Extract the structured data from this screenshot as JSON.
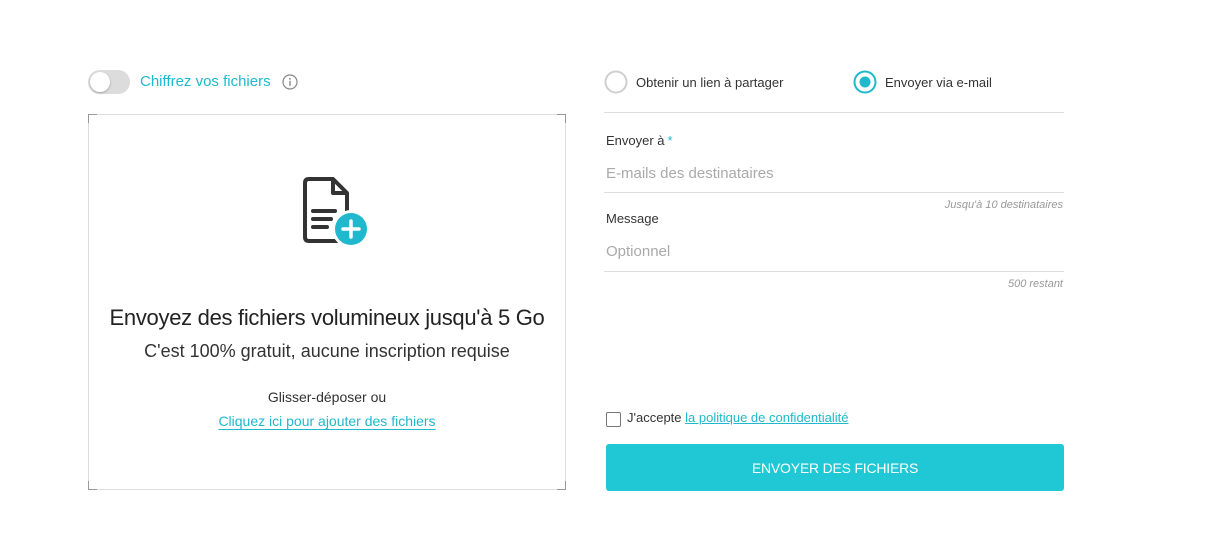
{
  "encryption": {
    "label": "Chiffrez vos fichiers",
    "enabled": false,
    "info_icon": "info-icon"
  },
  "dropzone": {
    "icon": "file-add-icon",
    "title": "Envoyez des fichiers volumineux jusqu'à 5 Go",
    "subtitle": "C'est 100% gratuit, aucune inscription requise",
    "drag_text": "Glisser-déposer ou",
    "link_text": "Cliquez ici pour ajouter des fichiers"
  },
  "share_mode": {
    "option_link": "Obtenir un lien à partager",
    "option_email": "Envoyer via e-mail",
    "selected": "email"
  },
  "form": {
    "to_label": "Envoyer à",
    "to_required_mark": "*",
    "to_placeholder": "E-mails des destinataires",
    "to_value": "",
    "to_hint": "Jusqu'à 10 destinataires",
    "message_label": "Message",
    "message_placeholder": "Optionnel",
    "message_value": "",
    "message_hint": "500 restant"
  },
  "consent": {
    "prefix": "J'accepte",
    "link_text": "la politique de confidentialité",
    "checked": false
  },
  "submit_label": "ENVOYER DES FICHIERS",
  "colors": {
    "accent": "#1fb8cd",
    "button": "#1fc8d4",
    "toggle_off": "#dcdcdc"
  }
}
